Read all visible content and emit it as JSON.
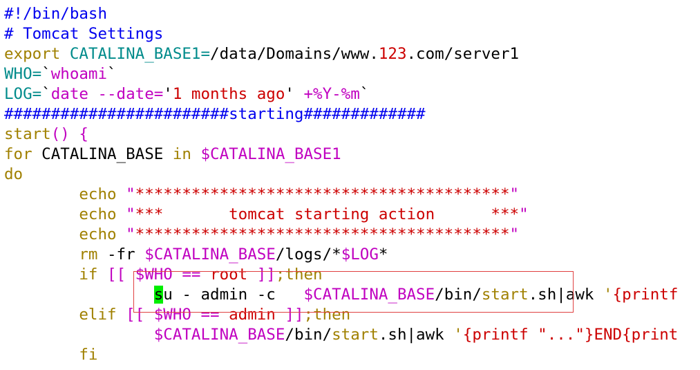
{
  "editor": {
    "colors": {
      "background": "#ffffff",
      "comment": "#0000ee",
      "keyword_cyan": "#008b8b",
      "variable_magenta": "#c000c0",
      "string_red": "#cc0000",
      "builtin_olive": "#a08000",
      "cursor": "#00ee00",
      "highlight_border": "#e04040"
    },
    "lines": [
      [
        {
          "c": "comment",
          "t": "#!/bin/bash"
        }
      ],
      [
        {
          "c": "comment",
          "t": "# Tomcat Settings"
        }
      ],
      [
        {
          "c": "olive",
          "t": "export "
        },
        {
          "c": "cyan",
          "t": "CATALINA_BASE1="
        },
        {
          "c": "plain",
          "t": "/data/Domains/www."
        },
        {
          "c": "red",
          "t": "123"
        },
        {
          "c": "plain",
          "t": ".com/server1"
        }
      ],
      [
        {
          "c": "cyan",
          "t": "WHO="
        },
        {
          "c": "plain",
          "t": "`"
        },
        {
          "c": "magenta",
          "t": "whoami"
        },
        {
          "c": "plain",
          "t": "`"
        }
      ],
      [
        {
          "c": "cyan",
          "t": "LOG="
        },
        {
          "c": "plain",
          "t": "`"
        },
        {
          "c": "magenta",
          "t": "date --date="
        },
        {
          "c": "plain",
          "t": "'"
        },
        {
          "c": "red",
          "t": "1 months ago"
        },
        {
          "c": "plain",
          "t": "'"
        },
        {
          "c": "magenta",
          "t": " +%Y-%m"
        },
        {
          "c": "plain",
          "t": "`"
        }
      ],
      [
        {
          "c": "comment",
          "t": "########################starting#############"
        }
      ],
      [
        {
          "c": "olive",
          "t": "start"
        },
        {
          "c": "magenta",
          "t": "() {"
        }
      ],
      [
        {
          "c": "olive",
          "t": "for"
        },
        {
          "c": "plain",
          "t": " CATALINA_BASE "
        },
        {
          "c": "olive",
          "t": "in"
        },
        {
          "c": "plain",
          "t": " "
        },
        {
          "c": "magenta",
          "t": "$CATALINA_BASE1"
        }
      ],
      [
        {
          "c": "olive",
          "t": "do"
        }
      ],
      [
        {
          "c": "plain",
          "t": "        "
        },
        {
          "c": "olive",
          "t": "echo"
        },
        {
          "c": "plain",
          "t": " "
        },
        {
          "c": "magenta",
          "t": "\""
        },
        {
          "c": "red",
          "t": "****************************************"
        },
        {
          "c": "magenta",
          "t": "\""
        }
      ],
      [
        {
          "c": "plain",
          "t": "        "
        },
        {
          "c": "olive",
          "t": "echo"
        },
        {
          "c": "plain",
          "t": " "
        },
        {
          "c": "magenta",
          "t": "\""
        },
        {
          "c": "red",
          "t": "***       tomcat starting action      ***"
        },
        {
          "c": "magenta",
          "t": "\""
        }
      ],
      [
        {
          "c": "plain",
          "t": "        "
        },
        {
          "c": "olive",
          "t": "echo"
        },
        {
          "c": "plain",
          "t": " "
        },
        {
          "c": "magenta",
          "t": "\""
        },
        {
          "c": "red",
          "t": "****************************************"
        },
        {
          "c": "magenta",
          "t": "\""
        }
      ],
      [
        {
          "c": "plain",
          "t": "        "
        },
        {
          "c": "olive",
          "t": "rm"
        },
        {
          "c": "plain",
          "t": " -fr "
        },
        {
          "c": "magenta",
          "t": "$CATALINA_BASE"
        },
        {
          "c": "plain",
          "t": "/logs/*"
        },
        {
          "c": "magenta",
          "t": "$LOG"
        },
        {
          "c": "plain",
          "t": "*"
        }
      ],
      [
        {
          "c": "plain",
          "t": "        "
        },
        {
          "c": "olive",
          "t": "if"
        },
        {
          "c": "plain",
          "t": " "
        },
        {
          "c": "magenta",
          "t": "[[ $WHO == "
        },
        {
          "c": "red",
          "t": "root"
        },
        {
          "c": "magenta",
          "t": " ]]"
        },
        {
          "c": "olive",
          "t": ";then"
        }
      ],
      [
        {
          "c": "plain",
          "t": "                "
        },
        {
          "c": "cursor",
          "t": "s"
        },
        {
          "c": "plain",
          "t": "u - admin -c   "
        },
        {
          "c": "magenta",
          "t": "$CATALINA_BASE"
        },
        {
          "c": "plain",
          "t": "/bin/"
        },
        {
          "c": "olive",
          "t": "start"
        },
        {
          "c": "plain",
          "t": ".sh|awk "
        },
        {
          "c": "olive",
          "t": "'"
        },
        {
          "c": "red",
          "t": "{printf"
        }
      ],
      [
        {
          "c": "plain",
          "t": "        "
        },
        {
          "c": "olive",
          "t": "elif"
        },
        {
          "c": "plain",
          "t": " "
        },
        {
          "c": "magenta",
          "t": "[[ $WHO == "
        },
        {
          "c": "red",
          "t": "admin"
        },
        {
          "c": "magenta",
          "t": " ]]"
        },
        {
          "c": "olive",
          "t": ";then"
        }
      ],
      [
        {
          "c": "plain",
          "t": "                "
        },
        {
          "c": "magenta",
          "t": "$CATALINA_BASE"
        },
        {
          "c": "plain",
          "t": "/bin/"
        },
        {
          "c": "olive",
          "t": "start"
        },
        {
          "c": "plain",
          "t": ".sh|awk "
        },
        {
          "c": "olive",
          "t": "'"
        },
        {
          "c": "red",
          "t": "{printf \"...\"}END{print"
        }
      ],
      [
        {
          "c": "plain",
          "t": "        "
        },
        {
          "c": "olive",
          "t": "fi"
        }
      ]
    ]
  }
}
